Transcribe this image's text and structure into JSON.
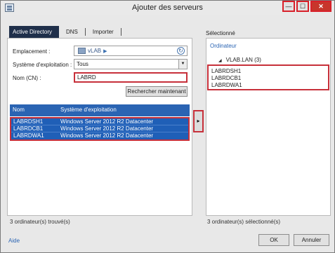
{
  "window": {
    "title": "Ajouter des serveurs",
    "controls": {
      "minimize": "—",
      "maximize": "☐",
      "close": "✕"
    }
  },
  "tabs": [
    {
      "label": "Active Directory",
      "active": true
    },
    {
      "label": "DNS",
      "active": false
    },
    {
      "label": "Importer",
      "active": false
    }
  ],
  "form": {
    "location_label": "Emplacement :",
    "location_value": "vLAB",
    "os_label": "Système d'exploitation :",
    "os_value": "Tous",
    "name_label": "Nom (CN) :",
    "name_value": "LABRD",
    "search_button": "Rechercher maintenant"
  },
  "results": {
    "columns": [
      "Nom",
      "Système d'exploitation"
    ],
    "rows": [
      {
        "name": "LABRDSH1",
        "os": "Windows Server 2012 R2 Datacenter"
      },
      {
        "name": "LABRDCB1",
        "os": "Windows Server 2012 R2 Datacenter"
      },
      {
        "name": "LABRDWA1",
        "os": "Windows Server 2012 R2 Datacenter"
      }
    ],
    "status": "3 ordinateur(s) trouvé(s)"
  },
  "transfer_button": "▸",
  "selection": {
    "title": "Sélectionné",
    "column": "Ordinateur",
    "group": "VLAB.LAN (3)",
    "items": [
      "LABRDSH1",
      "LABRDCB1",
      "LABRDWA1"
    ],
    "status": "3 ordinateur(s) sélectionné(s)"
  },
  "footer": {
    "help": "Aide",
    "ok": "OK",
    "cancel": "Annuler"
  },
  "colors": {
    "accent": "#2a64b3",
    "highlight": "#c7303a",
    "active_tab": "#1f2f4a"
  }
}
